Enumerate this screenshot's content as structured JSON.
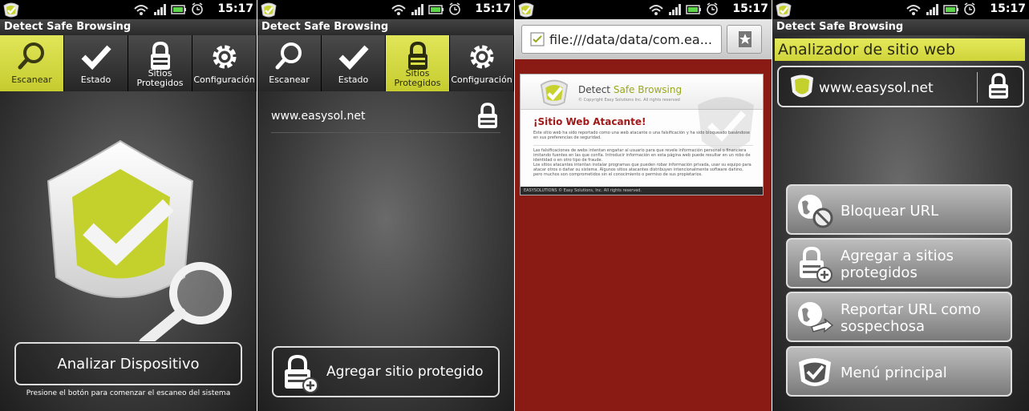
{
  "status": {
    "time": "15:17"
  },
  "app": {
    "title": "Detect Safe Browsing"
  },
  "tabs": [
    {
      "label": "Escanear",
      "icon": "magnifier-icon"
    },
    {
      "label": "Estado",
      "icon": "checkmark-icon"
    },
    {
      "label": "Sitios Protegidos",
      "icon": "padlock-icon"
    },
    {
      "label": "Configuración",
      "icon": "gear-icon"
    }
  ],
  "scan": {
    "button_label": "Analizar Dispositivo",
    "hint": "Presione el botón para comenzar el escaneo del sistema"
  },
  "protected": {
    "sites": [
      "www.easysol.net"
    ],
    "add_button_label": "Agregar sitio protegido"
  },
  "browser": {
    "url": "file:///data/data/com.ea...",
    "page": {
      "brand_left": "Detect",
      "brand_right": "Safe Browsing",
      "copyright": "© Copyright Easy Solutions Inc. All rights reserved",
      "heading": "¡Sitio Web Atacante!",
      "para1": "Este sitio web ha sido reportado como una web atacante o una falsificación y ha sido bloqueado basándose en sus preferencias de seguridad.",
      "para2": "Las falsificaciones de webs intentan engañar al usuario para que revele información personal o financiera imitando fuentes en las que confía. Introducir información en esta página web puede resultar en un robo de identidad o en otro tipo de fraude.",
      "para3": "Los sitios atacantes intentan instalar programas que pueden robar información privada, usar su equipo para atacar otros o dañar su sistema. Algunos sitios atacantes distribuyen intencionalmente software dañino, pero muchos son comprometidos sin el conocimiento o permiso de sus propietarios.",
      "footer": "EASYSOLUTIONS © Easy Solutions, Inc. All rights reserved."
    }
  },
  "analyzer": {
    "title": "Analizador de sitio web",
    "site": "www.easysol.net",
    "actions": [
      {
        "label": "Bloquear URL",
        "icon": "block-globe-icon"
      },
      {
        "label": "Agregar a sitios protegidos",
        "icon": "add-lock-icon"
      },
      {
        "label": "Reportar URL como sospechosa",
        "icon": "report-globe-icon"
      },
      {
        "label": "Menú principal",
        "icon": "shield-home-icon"
      }
    ]
  },
  "colors": {
    "accent": "#d4da3c",
    "webpage_bg": "#8a1a14",
    "attack_red": "#a01a1a"
  }
}
